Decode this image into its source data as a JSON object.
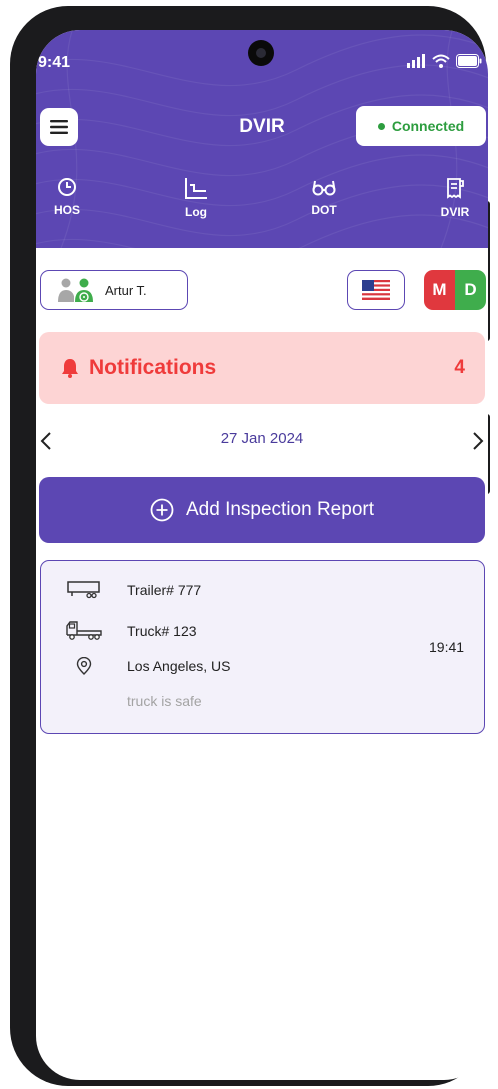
{
  "status_bar": {
    "time": "9:41"
  },
  "header": {
    "title": "DVIR",
    "connection": {
      "label": "Connected",
      "color": "#2d9d3f"
    },
    "tabs": [
      {
        "label": "HOS",
        "icon": "clock-icon"
      },
      {
        "label": "Log",
        "icon": "chart-line-icon"
      },
      {
        "label": "DOT",
        "icon": "glasses-icon"
      },
      {
        "label": "DVIR",
        "icon": "report-document-icon"
      }
    ]
  },
  "driver": {
    "name": "Artur T.",
    "icon": "driver-avatar-icon"
  },
  "language": {
    "icon": "us-flag-icon"
  },
  "mode": {
    "m": "M",
    "d": "D"
  },
  "notifications": {
    "label": "Notifications",
    "count": "4",
    "icon": "bell-icon"
  },
  "date_nav": {
    "date": "27 Jan 2024"
  },
  "add_report": {
    "label": "Add Inspection Report",
    "icon": "plus-circle-icon"
  },
  "inspection": {
    "trailer": "Trailer# 777",
    "truck": "Truck# 123",
    "location": "Los Angeles, US",
    "time": "19:41",
    "note": "truck is safe"
  },
  "colors": {
    "primary": "#5c47b3",
    "alert": "#ef3b3b",
    "alert_bg": "#fdd4d4",
    "online": "#3fad4c",
    "offline": "#e0383e"
  }
}
